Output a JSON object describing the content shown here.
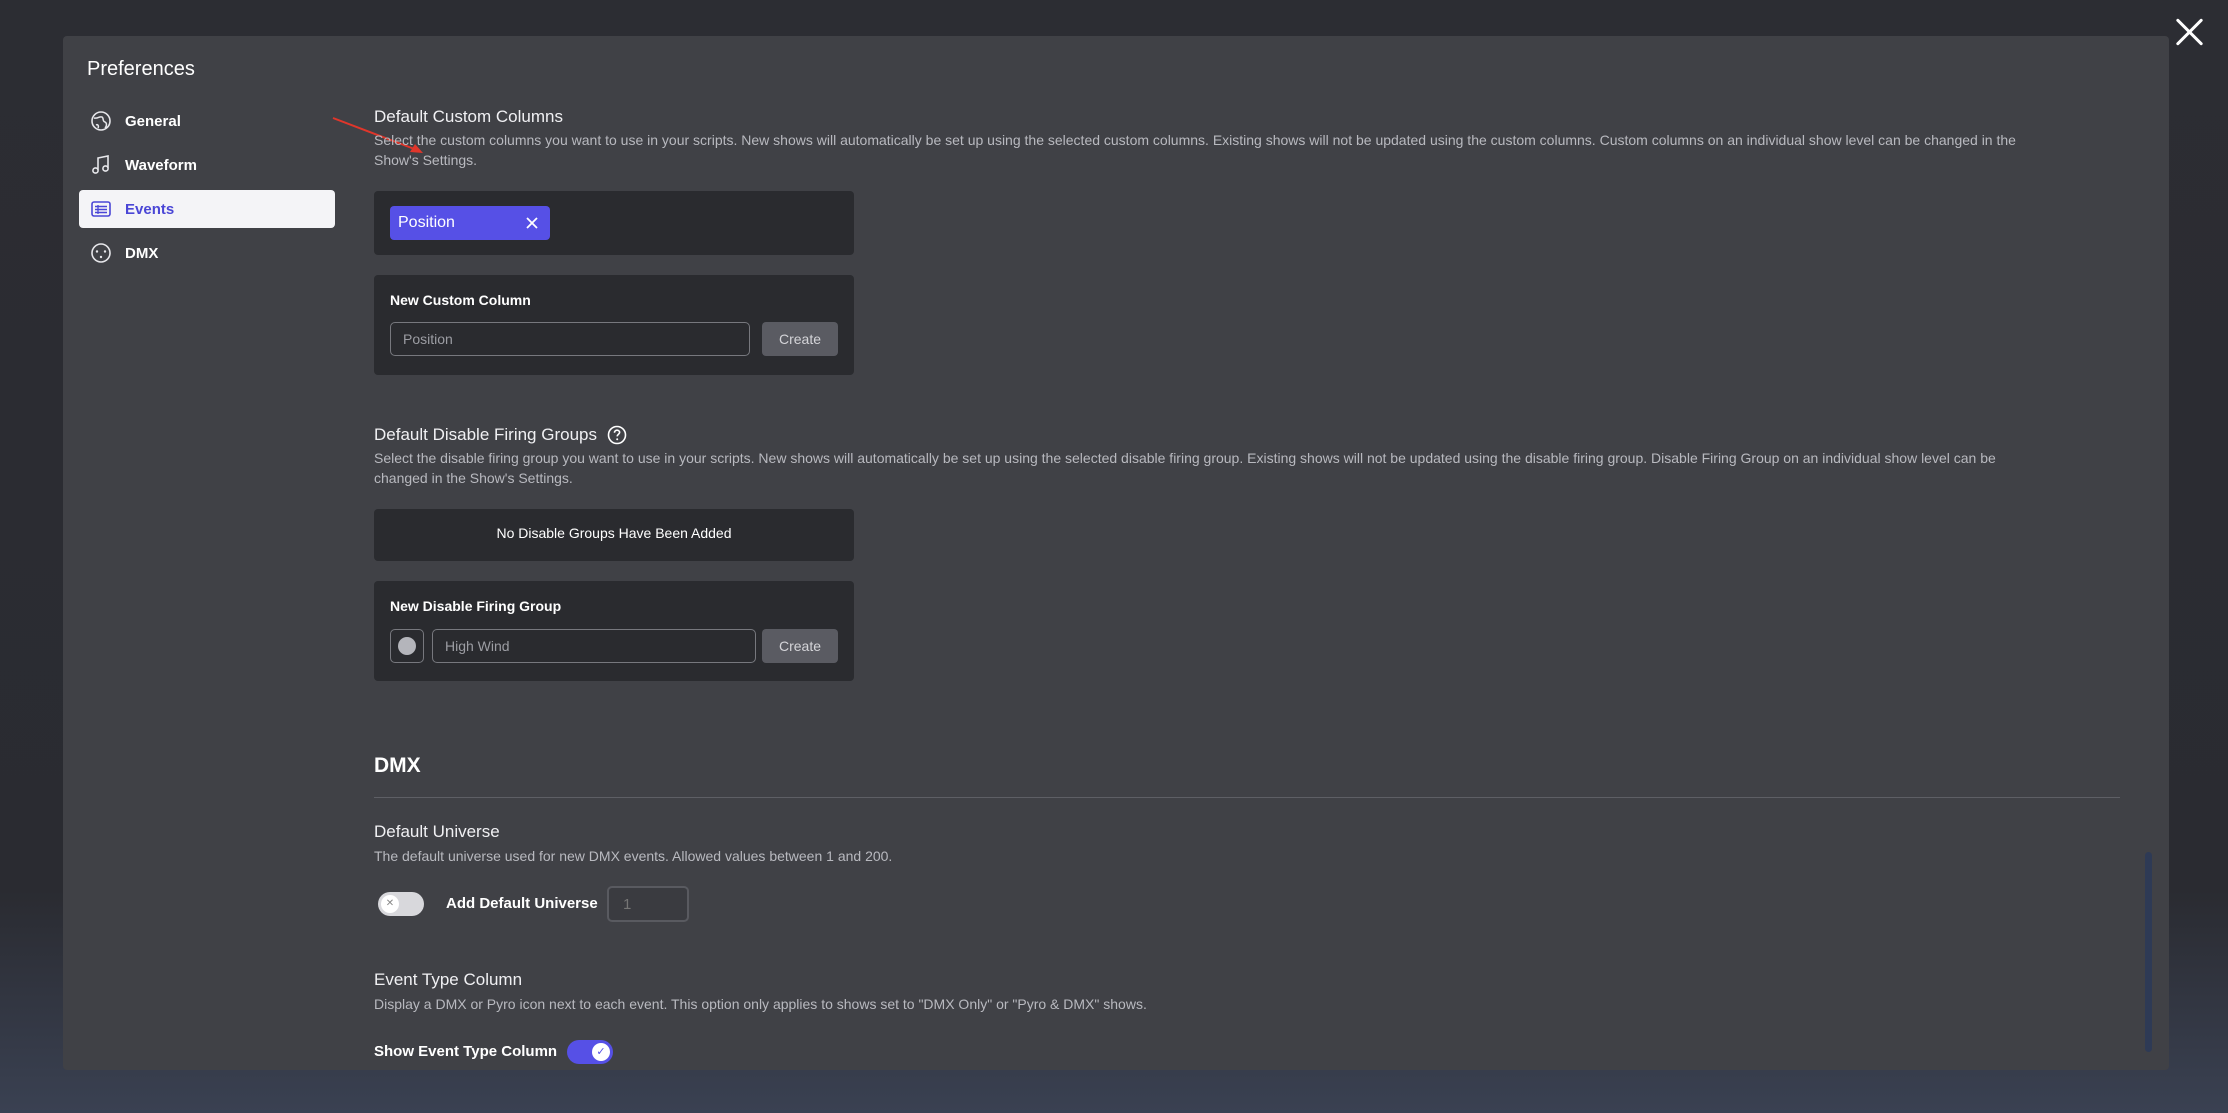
{
  "window": {
    "title": "Preferences"
  },
  "sidebar": {
    "items": [
      {
        "label": "General",
        "icon": "globe-icon",
        "active": false
      },
      {
        "label": "Waveform",
        "icon": "music-note-icon",
        "active": false
      },
      {
        "label": "Events",
        "icon": "list-table-icon",
        "active": true
      },
      {
        "label": "DMX",
        "icon": "dmx-connector-icon",
        "active": false
      }
    ]
  },
  "custom_columns": {
    "title": "Default Custom Columns",
    "description_line1": "Select the custom columns you want to use in your scripts. New shows will automatically be set up using the selected custom columns. Existing shows will not be updated using the custom columns. Custom columns on an individual show level can be changed in the",
    "description_line2": "Show's Settings.",
    "selected": [
      {
        "label": "Position"
      }
    ],
    "new_label": "New Custom Column",
    "input_placeholder": "Position",
    "create_label": "Create"
  },
  "disable_groups": {
    "title": "Default Disable Firing Groups",
    "description_line1": "Select the disable firing group you want to use in your scripts. New shows will automatically be set up using the selected disable firing group. Existing shows will not be updated using the disable firing group. Disable Firing Group on an individual show level can be",
    "description_line2": "changed in the Show's Settings.",
    "empty_text": "No Disable Groups Have Been Added",
    "new_label": "New Disable Firing Group",
    "input_placeholder": "High Wind",
    "create_label": "Create",
    "color": "#b4b5bb"
  },
  "dmx": {
    "heading": "DMX",
    "default_universe": {
      "title": "Default Universe",
      "description": "The default universe used for new DMX events. Allowed values between 1 and 200.",
      "toggle_label": "Add Default Universe",
      "toggle_on": false,
      "value_placeholder": "1"
    },
    "event_type": {
      "title": "Event Type Column",
      "description": "Display a DMX or Pyro icon next to each event. This option only applies to shows set to \"DMX Only\" or \"Pyro & DMX\" shows.",
      "toggle_label": "Show Event Type Column",
      "toggle_on": true
    }
  },
  "colors": {
    "accent": "#5650e6",
    "modal_bg": "#404146",
    "card_bg": "#2a2b2f",
    "annotation_arrow": "#e0362b"
  }
}
